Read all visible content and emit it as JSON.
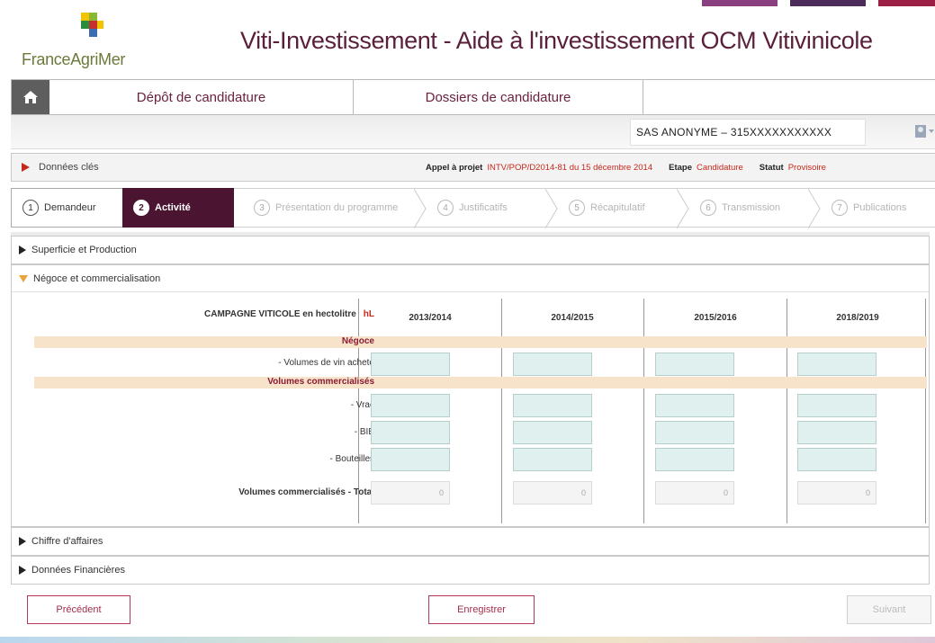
{
  "colors": {
    "brand": "#5a1f3a",
    "accent": "#c5281c",
    "active_step": "#4b1430",
    "band": "#f7e3c9",
    "input": "#dff0ee"
  },
  "top_bars": [
    {
      "color": "#8a3f7e"
    },
    {
      "color": "#4b2b59"
    },
    {
      "color": "#9b1e44"
    }
  ],
  "header": {
    "logo_text": "FranceAgriMer",
    "title": "Viti-Investissement - Aide à l'investissement OCM Vitivinicole"
  },
  "nav": {
    "home_icon": "home-icon",
    "tabs": [
      {
        "label": "Dépôt de candidature"
      },
      {
        "label": "Dossiers de candidature"
      },
      {
        "label": ""
      }
    ]
  },
  "user": {
    "name": "SAS ANONYME – 315XXXXXXXXXXX",
    "icon": "user-dropdown-icon"
  },
  "info": {
    "label": "Données clés",
    "appel_label": "Appel à projet",
    "appel_value": "INTV/POP/D2014-81 du 15 décembre 2014",
    "etape_label": "Etape",
    "etape_value": "Candidature",
    "statut_label": "Statut",
    "statut_value": "Provisoire"
  },
  "steps": [
    {
      "num": "1",
      "label": "Demandeur",
      "state": "done"
    },
    {
      "num": "2",
      "label": "Activité",
      "state": "active"
    },
    {
      "num": "3",
      "label": "Présentation du programme",
      "state": "future"
    },
    {
      "num": "4",
      "label": "Justificatifs",
      "state": "future"
    },
    {
      "num": "5",
      "label": "Récapitulatif",
      "state": "future"
    },
    {
      "num": "6",
      "label": "Transmission",
      "state": "future"
    },
    {
      "num": "7",
      "label": "Publications",
      "state": "future"
    }
  ],
  "sections": {
    "superficie": "Superficie et Production",
    "negoce": "Négoce et commercialisation",
    "chiffre": "Chiffre d'affaires",
    "donnees_fin": "Données Financières"
  },
  "table": {
    "title": "CAMPAGNE VITICOLE en hectolitre",
    "unit": "hL",
    "years": [
      "2013/2014",
      "2014/2015",
      "2015/2016",
      "2018/2019"
    ],
    "negoce_label": "Négoce",
    "vin_achete_label": "- Volumes de vin acheté",
    "volumes_label": "Volumes commercialisés",
    "vrac_label": "- Vrac",
    "bib_label": "- BIB",
    "bouteilles_label": "- Bouteilles",
    "total_label": "Volumes commercialisés - Total",
    "totals": [
      "0",
      "0",
      "0",
      "0"
    ]
  },
  "buttons": {
    "prev": "Précédent",
    "save": "Enregistrer",
    "next": "Suivant"
  }
}
